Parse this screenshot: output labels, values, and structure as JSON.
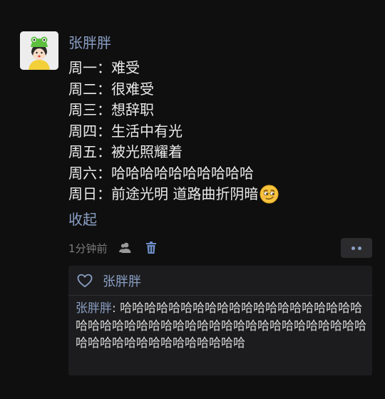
{
  "post": {
    "author": "张胖胖",
    "lines": [
      "周一：难受",
      "周二：很难受",
      "周三：想辞职",
      "周四：生活中有光",
      "周五：被光照耀着",
      "周六：哈哈哈哈哈哈哈哈哈哈",
      "周日：前途光明 道路曲折阴暗"
    ],
    "collapse_label": "收起",
    "time": "1分钟前"
  },
  "icons": {
    "avatar": "frog-hat-girl-avatar",
    "emoji": "smirk-emoji",
    "visibility": "people-icon",
    "delete": "trash-icon",
    "more": "more-dots-icon",
    "like": "heart-icon"
  },
  "comments": {
    "likes": [
      "张胖胖"
    ],
    "items": [
      {
        "name": "张胖胖",
        "separator": ": ",
        "text": "哈哈哈哈哈哈哈哈哈哈哈哈哈哈哈哈哈哈哈哈哈哈哈哈哈哈哈哈哈哈哈哈哈哈哈哈哈哈哈哈哈哈哈哈哈哈哈哈哈哈哈哈哈哈哈哈哈哈"
      }
    ]
  },
  "colors": {
    "background": "#0f0f0f",
    "link": "#8a9fc4",
    "panel": "#1c1c1e",
    "muted": "#7b7b7b"
  }
}
